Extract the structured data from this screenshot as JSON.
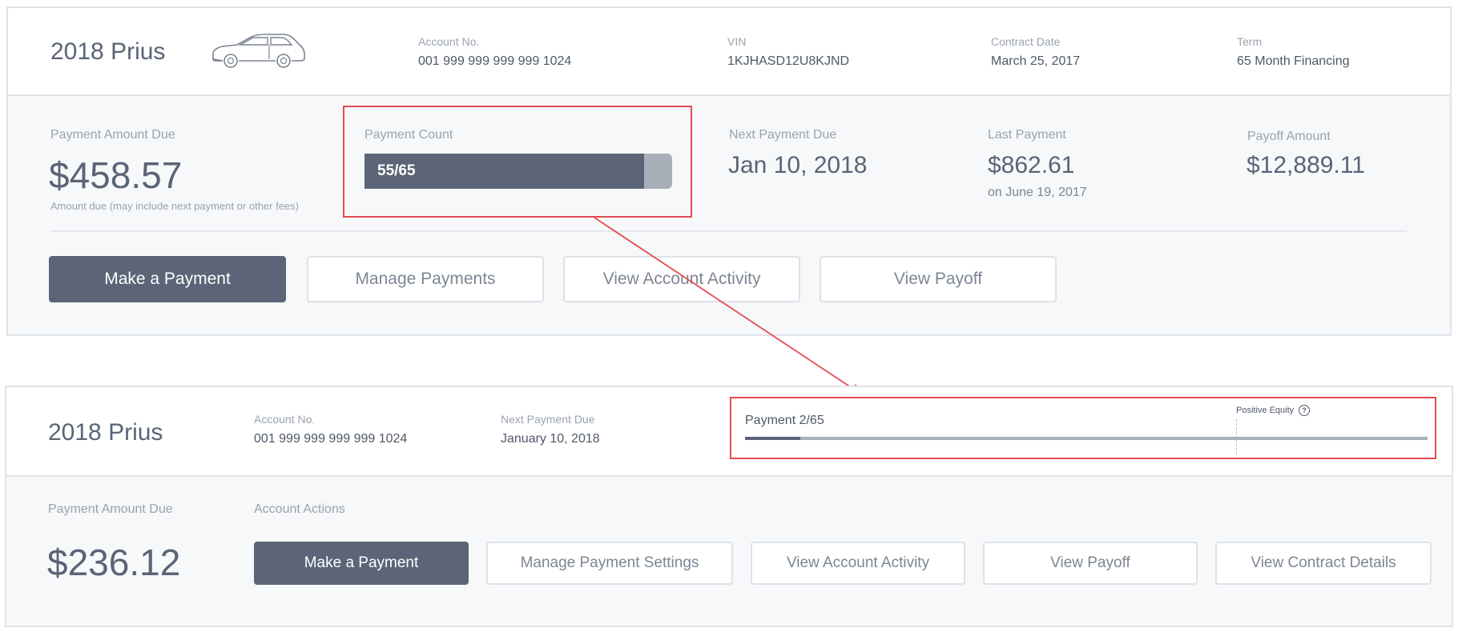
{
  "top_card": {
    "car_name": "2018 Prius",
    "car_icon": "car-icon",
    "account_label": "Account No.",
    "account_value": "001 999 999 999 999 1024",
    "vin_label": "VIN",
    "vin_value": "1KJHASD12U8KJND",
    "contract_label": "Contract Date",
    "contract_value": "March 25, 2017",
    "term_label": "Term",
    "term_value": "65 Month Financing",
    "payment_due_label": "Payment Amount Due",
    "payment_due_value": "$458.57",
    "payment_due_note": "Amount due (may include next payment or other fees)",
    "payment_count_label": "Payment Count",
    "payment_count_text": "55/65",
    "payment_count_progress": 0.908,
    "next_payment_label": "Next Payment Due",
    "next_payment_value": "Jan 10, 2018",
    "last_payment_label": "Last Payment",
    "last_payment_value": "$862.61",
    "last_payment_date": "on June 19, 2017",
    "payoff_label": "Payoff Amount",
    "payoff_value": "$12,889.11",
    "buttons": {
      "make_payment": "Make a Payment",
      "manage_payments": "Manage Payments",
      "view_activity": "View Account Activity",
      "view_payoff": "View Payoff"
    }
  },
  "bottom_card": {
    "car_name": "2018 Prius",
    "account_label": "Account No.",
    "account_value": "001 999 999 999 999 1024",
    "next_payment_label": "Next Payment Due",
    "next_payment_value": "January 10, 2018",
    "payment_progress_label": "Payment 2/65",
    "payment_progress": 0.081,
    "positive_equity_label": "Positive Equity",
    "positive_equity_marker": 0.72,
    "help_icon": "question-circle-icon",
    "payment_due_label": "Payment Amount Due",
    "payment_due_value": "$236.12",
    "account_actions_label": "Account Actions",
    "buttons": {
      "make_payment": "Make a Payment",
      "manage_settings": "Manage Payment Settings",
      "view_activity": "View Account Activity",
      "view_payoff": "View Payoff",
      "view_contract": "View Contract Details"
    }
  },
  "colors": {
    "highlight": "#e54b52",
    "primary_button": "#5b6577",
    "progress_track": "#a9afb8"
  }
}
